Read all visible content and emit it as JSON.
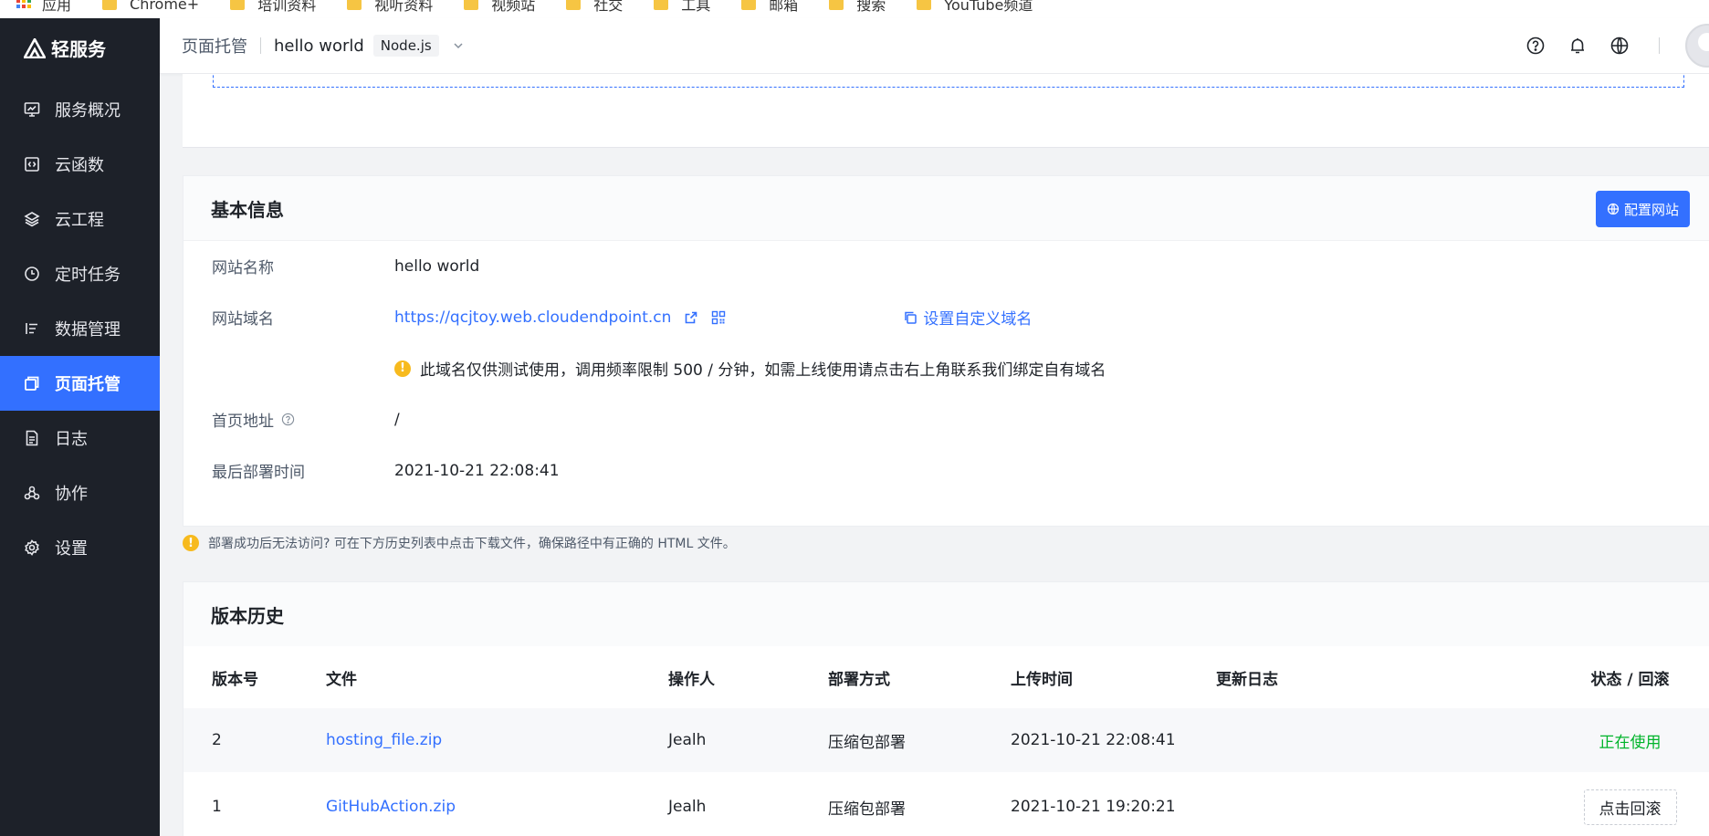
{
  "bookmarks": [
    {
      "label": "应用",
      "icon": "apps-icon"
    },
    {
      "label": "Chrome+",
      "icon": "folder-icon"
    },
    {
      "label": "培训资料",
      "icon": "folder-icon"
    },
    {
      "label": "视听资料",
      "icon": "folder-icon"
    },
    {
      "label": "视频站",
      "icon": "folder-icon"
    },
    {
      "label": "社交",
      "icon": "folder-icon"
    },
    {
      "label": "工具",
      "icon": "folder-icon"
    },
    {
      "label": "邮箱",
      "icon": "folder-icon"
    },
    {
      "label": "搜索",
      "icon": "folder-icon"
    },
    {
      "label": "YouTube频道",
      "icon": "folder-icon"
    }
  ],
  "logo": {
    "text": "轻服务"
  },
  "sidebar": {
    "items": [
      {
        "label": "服务概况",
        "icon": "dashboard-icon"
      },
      {
        "label": "云函数",
        "icon": "function-icon"
      },
      {
        "label": "云工程",
        "icon": "layers-icon"
      },
      {
        "label": "定时任务",
        "icon": "clock-icon"
      },
      {
        "label": "数据管理",
        "icon": "database-icon"
      },
      {
        "label": "页面托管",
        "icon": "hosting-icon",
        "active": true
      },
      {
        "label": "日志",
        "icon": "log-icon"
      },
      {
        "label": "协作",
        "icon": "collab-icon"
      },
      {
        "label": "设置",
        "icon": "settings-icon"
      }
    ]
  },
  "header": {
    "section": "页面托管",
    "app_name": "hello world",
    "runtime_tag": "Node.js",
    "icons": [
      "help-icon",
      "bell-icon",
      "globe-icon"
    ]
  },
  "basic_info": {
    "title": "基本信息",
    "configure_button": "配置网站",
    "site_name_label": "网站名称",
    "site_name": "hello world",
    "domain_label": "网站域名",
    "domain": "https://qcjtoy.web.cloudendpoint.cn",
    "custom_domain_link": "设置自定义域名",
    "domain_notice": "此域名仅供测试使用，调用频率限制 500 / 分钟，如需上线使用请点击右上角联系我们绑定自有域名",
    "homepage_label": "首页地址",
    "homepage": "/",
    "last_deploy_label": "最后部署时间",
    "last_deploy": "2021-10-21 22:08:41"
  },
  "tip": "部署成功后无法访问? 可在下方历史列表中点击下载文件，确保路径中有正确的 HTML 文件。",
  "history": {
    "title": "版本历史",
    "columns": [
      "版本号",
      "文件",
      "操作人",
      "部署方式",
      "上传时间",
      "更新日志",
      "状态 / 回滚"
    ],
    "rows": [
      {
        "version": "2",
        "file": "hosting_file.zip",
        "operator": "Jealh",
        "method": "压缩包部署",
        "time": "2021-10-21 22:08:41",
        "log": "",
        "status": "正在使用"
      },
      {
        "version": "1",
        "file": "GitHubAction.zip",
        "operator": "Jealh",
        "method": "压缩包部署",
        "time": "2021-10-21 19:20:21",
        "log": "",
        "status": "点击回滚"
      }
    ]
  },
  "colors": {
    "primary": "#3370ff",
    "sidebar_bg": "#1d2129",
    "success": "#00b42a",
    "warning": "#f7ba1e"
  }
}
